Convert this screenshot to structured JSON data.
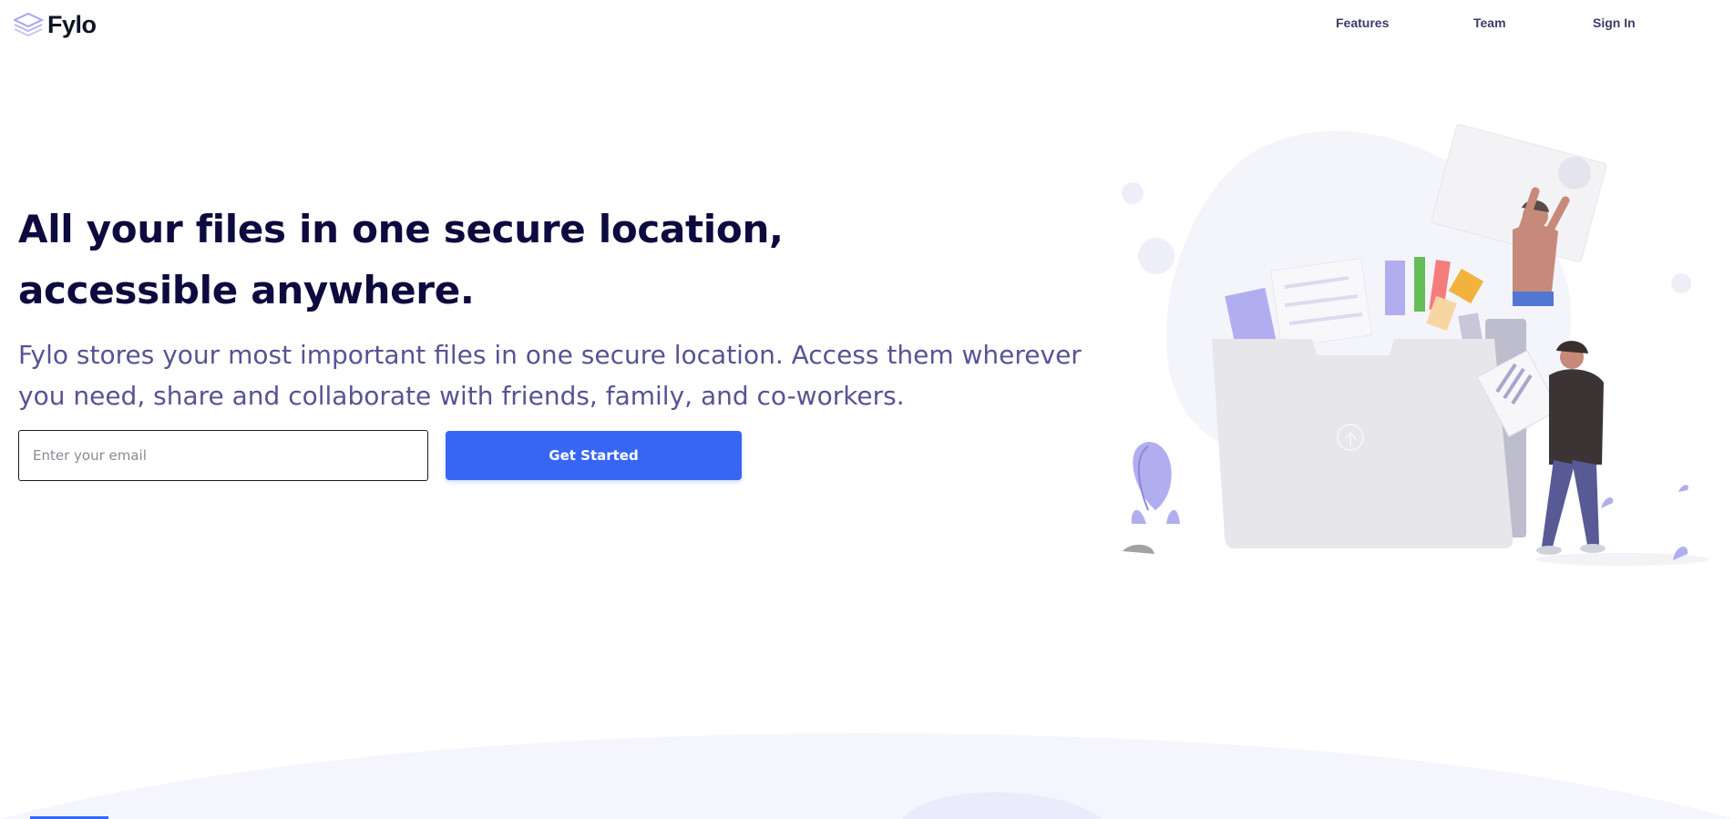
{
  "brand": {
    "name": "Fylo",
    "logo_icon": "stacked-layers-icon",
    "accent_color": "#3766f4",
    "heading_color": "#0c0a3e",
    "subtext_color": "#565493"
  },
  "nav": {
    "items": [
      {
        "label": "Features"
      },
      {
        "label": "Team"
      },
      {
        "label": "Sign In"
      }
    ]
  },
  "hero": {
    "title": "All your files in one secure location, accessible anywhere.",
    "subtitle": "Fylo stores your most important files in one secure location. Access them wherever you need, share and collaborate with friends, family, and co-workers.",
    "email_placeholder": "Enter your email",
    "email_value": "",
    "cta_label": "Get Started",
    "illustration": "people-organizing-files-in-folder-illustration"
  }
}
